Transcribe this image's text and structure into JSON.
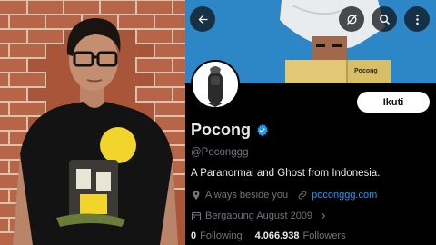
{
  "profile": {
    "name": "Pocong",
    "handle": "@Poconggg",
    "bio": "A Paranormal and Ghost from Indonesia.",
    "location": "Always beside you",
    "website": "poconggg.com",
    "joined": "Bergabung August 2009",
    "following_count": "0",
    "following_label": "Following",
    "followers_count": "4.066.938",
    "followers_label": "Followers"
  },
  "actions": {
    "follow_label": "Ikuti"
  },
  "banner": {
    "book_text": "Pocong"
  },
  "icons": {
    "back": "arrow-left-icon",
    "notify": "bell-off-icon",
    "search": "search-icon",
    "more": "more-vertical-icon",
    "verified": "verified-badge-icon",
    "location": "location-pin-icon",
    "link": "link-icon",
    "calendar": "calendar-icon",
    "chevron": "chevron-right-icon"
  },
  "colors": {
    "accent": "#1d9bf0",
    "background": "#000000",
    "text_primary": "#e7e9ea",
    "text_secondary": "#71767b"
  }
}
